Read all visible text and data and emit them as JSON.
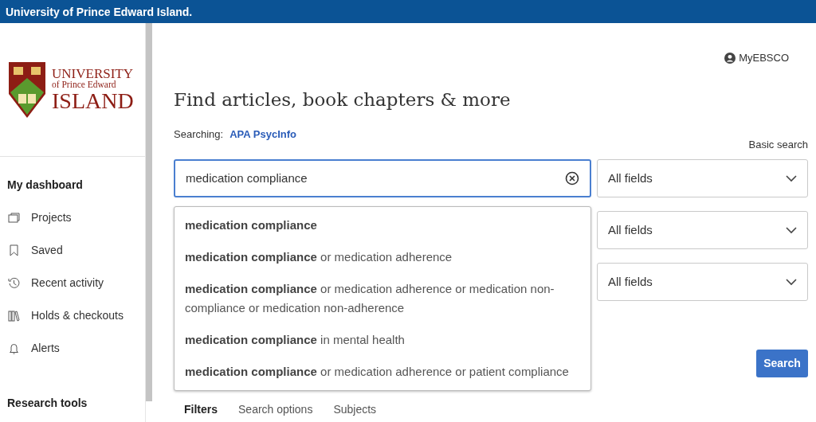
{
  "top_bar": {
    "title": "University of Prince Edward Island."
  },
  "logo": {
    "line_1": "UNIVERSITY",
    "line_2": "of Prince Edward",
    "line_3": "ISLAND"
  },
  "sidebar": {
    "sections": [
      {
        "heading": "My dashboard",
        "items": [
          {
            "label": "Projects"
          },
          {
            "label": "Saved"
          },
          {
            "label": "Recent activity"
          },
          {
            "label": "Holds & checkouts"
          },
          {
            "label": "Alerts"
          }
        ]
      },
      {
        "heading": "Research tools"
      }
    ]
  },
  "account": {
    "label": "MyEBSCO"
  },
  "heading": "Find articles, book chapters & more",
  "searching": {
    "label": "Searching:",
    "database": "APA PsycInfo"
  },
  "basic_search": "Basic search",
  "search_field": {
    "value": "medication compliance"
  },
  "field_selects": [
    "All fields",
    "All fields",
    "All fields"
  ],
  "suggestions": [
    "**medication compliance**",
    "**medication compliance** or medication adherence",
    "**medication compliance** or medication adherence or medication non-compliance or medication non-adherence",
    "**medication compliance** in mental health",
    "**medication compliance** or medication adherence or patient compliance"
  ],
  "search_button": "Search",
  "tabs": [
    {
      "label": "Filters",
      "selected": true
    },
    {
      "label": "Search options",
      "selected": false
    },
    {
      "label": "Subjects",
      "selected": false
    }
  ]
}
